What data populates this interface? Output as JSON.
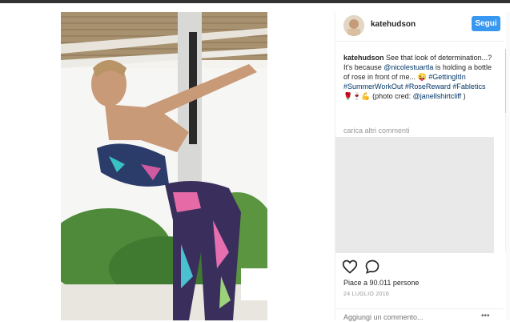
{
  "post": {
    "username": "katehudson",
    "follow_label": "Segui",
    "caption": {
      "username": "katehudson",
      "text1": "See that look of determination...? It's because ",
      "mention1": "@nicolestuartla",
      "text2": " is holding a bottle of rose in front of me... 😜 ",
      "hashtag1": "#GettingItIn",
      "hashtag2": "#SummerWorkOut",
      "hashtag3": "#RoseReward",
      "hashtag4": "#Fabletics",
      "emoji": "🌹🍷💪",
      "text3": " (photo cred: ",
      "mention2": "@janellshirtcliff",
      "text4": " )"
    },
    "load_more": "carica altri commenti",
    "likes": "Piace a 90.011 persone",
    "date": "24 LUGLIO 2016",
    "comment_placeholder": "Aggiungi un commento...",
    "more_icon": "ellipsis-icon",
    "like_icon": "heart-icon",
    "comment_icon": "speech-bubble-icon"
  }
}
